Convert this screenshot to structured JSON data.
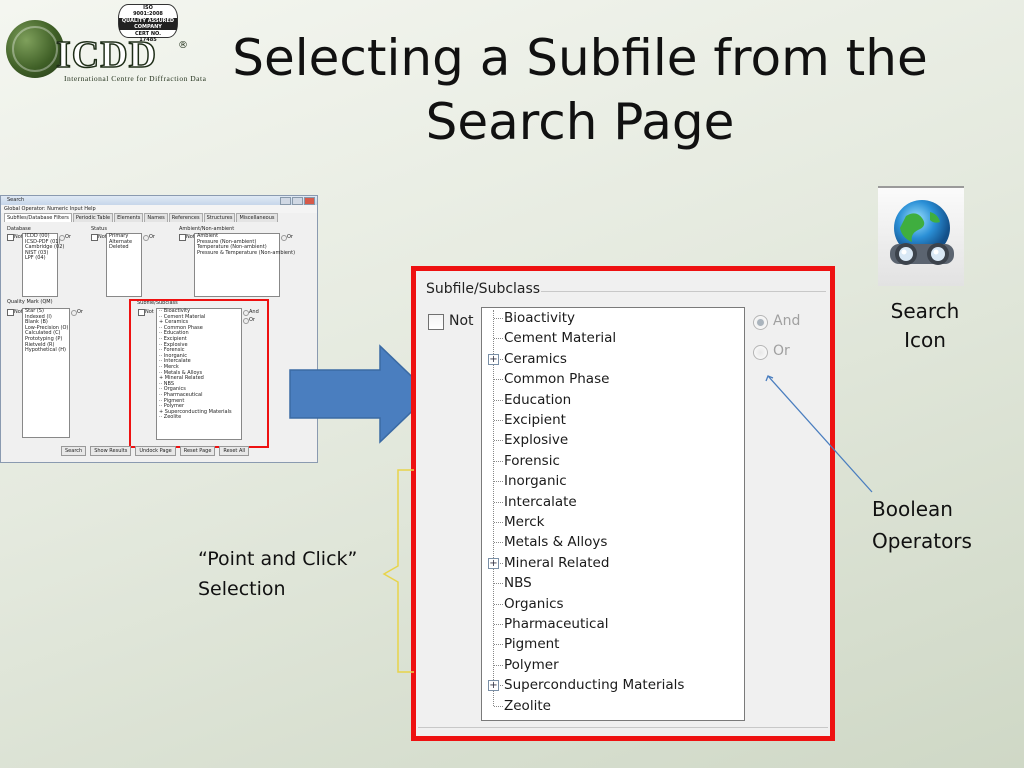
{
  "slide": {
    "title_line1": "Selecting a Subfile from the",
    "title_line2": "Search Page"
  },
  "logo": {
    "name": "ICDD",
    "registered": "®",
    "subtitle": "International Centre for Diffraction Data",
    "iso_line1": "ISO",
    "iso_line2": "9001:2008",
    "iso_band": "QUALITY ASSURED COMPANY",
    "iso_line3": "CERT NO.",
    "iso_line4": "17485"
  },
  "mini_window": {
    "title": "Search",
    "menu": "Global Operator:  Numeric Input   Help",
    "tabs": [
      "Subfiles/Database Filters",
      "Periodic Table",
      "Elements",
      "Names",
      "References",
      "Structures",
      "Miscellaneous"
    ],
    "database_label": "Database",
    "database_items": [
      "ICDD (00)",
      "ICSD-PDF (01)",
      "Cambridge (02)",
      "NIST (03)",
      "LPF (04)"
    ],
    "status_label": "Status",
    "status_items": [
      "Primary",
      "Alternate",
      "Deleted"
    ],
    "ambient_label": "Ambient/Non-ambient",
    "ambient_items": [
      "Ambient",
      "Pressure (Non-ambient)",
      "Temperature (Non-ambient)",
      "Pressure & Temperature (Non-ambient)"
    ],
    "qm_label": "Quality Mark (QM)",
    "qm_items": [
      "Star (S)",
      "Indexed (I)",
      "Blank (B)",
      "Low-Precision (O)",
      "Calculated (C)",
      "Prototyping (P)",
      "Rietveld (R)",
      "Hypothetical (H)"
    ],
    "subfile_label": "Subfile/Subclass",
    "not_label": "Not",
    "or_label": "Or",
    "and_label": "And",
    "buttons": [
      "Search",
      "Show Results",
      "Undock Page",
      "Reset Page",
      "Reset All"
    ]
  },
  "zoom_panel": {
    "group_title": "Subfile/Subclass",
    "not_label": "Not",
    "and_label": "And",
    "or_label": "Or",
    "items": [
      {
        "label": "Bioactivity",
        "expandable": false
      },
      {
        "label": "Cement Material",
        "expandable": false
      },
      {
        "label": "Ceramics",
        "expandable": true
      },
      {
        "label": "Common Phase",
        "expandable": false
      },
      {
        "label": "Education",
        "expandable": false
      },
      {
        "label": "Excipient",
        "expandable": false
      },
      {
        "label": "Explosive",
        "expandable": false
      },
      {
        "label": "Forensic",
        "expandable": false
      },
      {
        "label": "Inorganic",
        "expandable": false
      },
      {
        "label": "Intercalate",
        "expandable": false
      },
      {
        "label": "Merck",
        "expandable": false
      },
      {
        "label": "Metals & Alloys",
        "expandable": false
      },
      {
        "label": "Mineral Related",
        "expandable": true
      },
      {
        "label": "NBS",
        "expandable": false
      },
      {
        "label": "Organics",
        "expandable": false
      },
      {
        "label": "Pharmaceutical",
        "expandable": false
      },
      {
        "label": "Pigment",
        "expandable": false
      },
      {
        "label": "Polymer",
        "expandable": false
      },
      {
        "label": "Superconducting Materials",
        "expandable": true
      },
      {
        "label": "Zeolite",
        "expandable": false
      }
    ]
  },
  "annotations": {
    "search_icon_line1": "Search",
    "search_icon_line2": "Icon",
    "boolean_line1": "Boolean",
    "boolean_line2": "Operators",
    "point_line1": "“Point and Click”",
    "point_line2": "Selection"
  },
  "colors": {
    "highlight_red": "#ee1111",
    "arrow_blue": "#4a7ebf",
    "brace_yellow": "#e8d44a",
    "callout_blue": "#4a7ebf"
  }
}
